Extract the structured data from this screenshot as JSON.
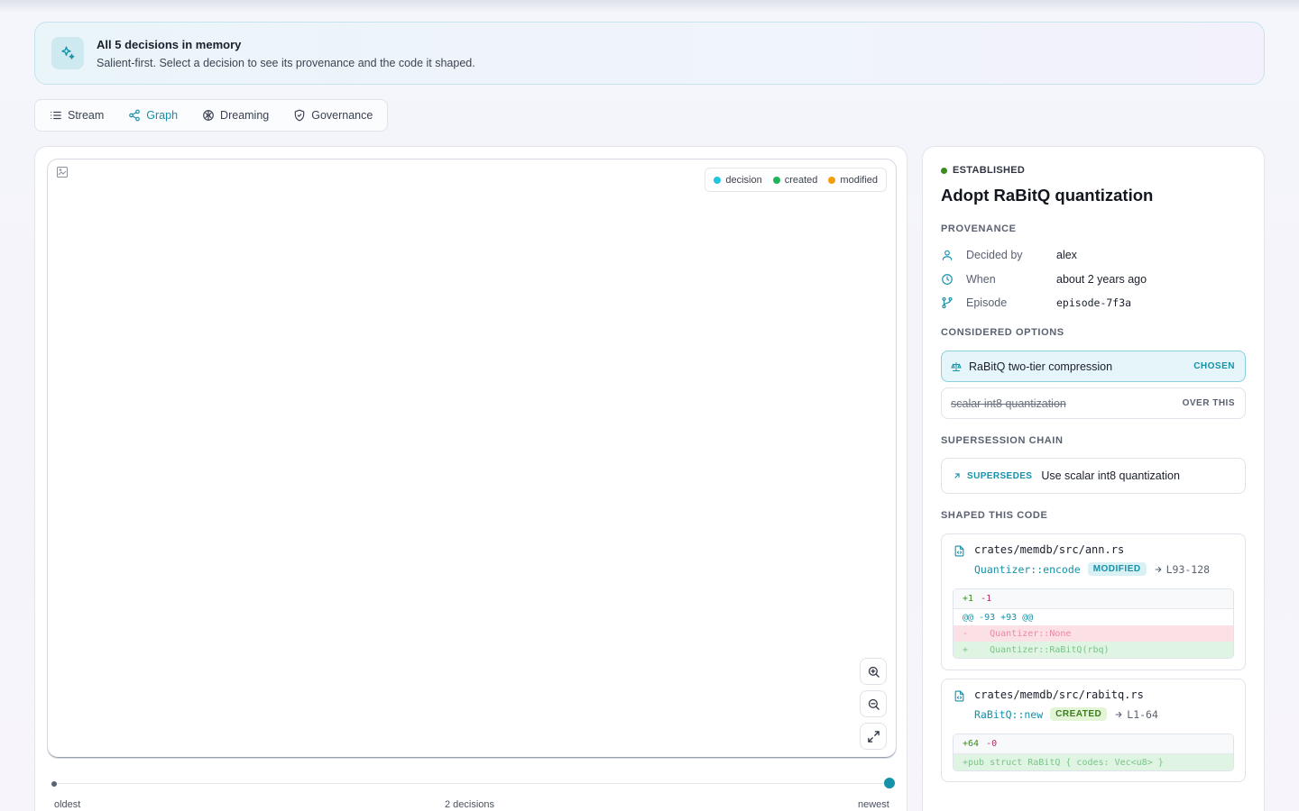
{
  "banner": {
    "title": "All 5 decisions in memory",
    "subtitle": "Salient-first. Select a decision to see its provenance and the code it shaped."
  },
  "tabs": [
    {
      "label": "Stream",
      "icon": "list-icon",
      "active": false
    },
    {
      "label": "Graph",
      "icon": "graph-icon",
      "active": true
    },
    {
      "label": "Dreaming",
      "icon": "brain-icon",
      "active": false
    },
    {
      "label": "Governance",
      "icon": "shield-icon",
      "active": false
    }
  ],
  "graph": {
    "legend": [
      {
        "label": "decision",
        "color": "#22c5e0"
      },
      {
        "label": "created",
        "color": "#22b45a"
      },
      {
        "label": "modified",
        "color": "#f59e0b"
      }
    ],
    "timeline": {
      "start_label": "oldest",
      "middle_label": "2 decisions",
      "end_label": "newest"
    }
  },
  "detail": {
    "status": "ESTABLISHED",
    "status_color": "#3a8a1e",
    "title": "Adopt RaBitQ quantization",
    "provenance_label": "PROVENANCE",
    "provenance": {
      "decided_by_key": "Decided by",
      "decided_by_val": "alex",
      "when_key": "When",
      "when_val": "about 2 years ago",
      "episode_key": "Episode",
      "episode_val": "episode-7f3a"
    },
    "options_label": "CONSIDERED OPTIONS",
    "options": [
      {
        "label": "RaBitQ two-tier compression",
        "tag": "CHOSEN"
      },
      {
        "label": "scalar int8 quantization",
        "tag": "OVER THIS"
      }
    ],
    "chain_label": "SUPERSESSION CHAIN",
    "chain": {
      "tag": "SUPERSEDES",
      "text": "Use scalar int8 quantization"
    },
    "code_label": "SHAPED THIS CODE",
    "code": [
      {
        "path": "crates/memdb/src/ann.rs",
        "symbol": "Quantizer::encode",
        "badge": "MODIFIED",
        "range": "L93-128",
        "plus": "+1",
        "minus": "-1",
        "hunk": "@@ -93 +93 @@",
        "removed": "-    Quantizer::None",
        "added": "+    Quantizer::RaBitQ(rbq)"
      },
      {
        "path": "crates/memdb/src/rabitq.rs",
        "symbol": "RaBitQ::new",
        "badge": "CREATED",
        "range": "L1-64",
        "plus": "+64",
        "minus": "-0",
        "added": "+pub struct RaBitQ { codes: Vec<u8> }"
      }
    ]
  }
}
